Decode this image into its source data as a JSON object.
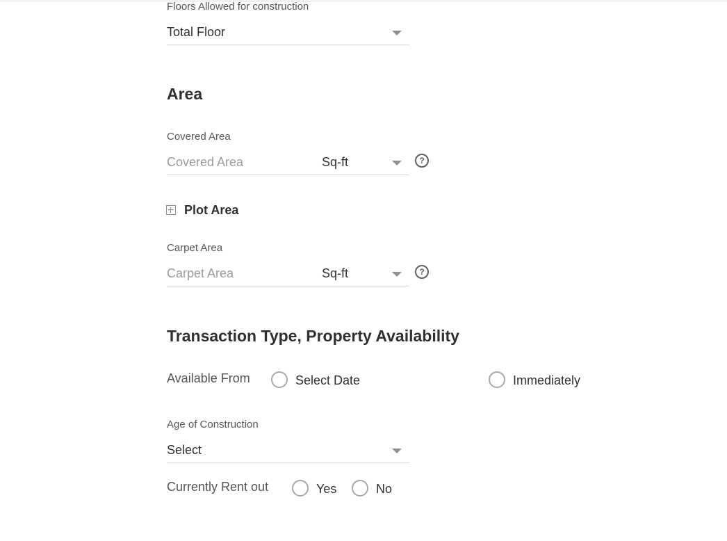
{
  "floors": {
    "label": "Floors Allowed for construction",
    "value": "Total Floor",
    "caret_icon": "chevron-down-icon"
  },
  "area": {
    "heading": "Area",
    "covered": {
      "label": "Covered Area",
      "placeholder": "Covered Area",
      "unit": "Sq-ft",
      "help": "?"
    },
    "plot": {
      "label": "Plot Area",
      "icon": "expand-plus-icon"
    },
    "carpet": {
      "label": "Carpet Area",
      "placeholder": "Carpet Area",
      "unit": "Sq-ft",
      "help": "?"
    }
  },
  "transaction": {
    "heading": "Transaction Type, Property Availability",
    "available_from": {
      "label": "Available From",
      "options": [
        "Select Date",
        "Immediately"
      ]
    },
    "age": {
      "label": "Age of Construction",
      "value": "Select"
    },
    "rent_out": {
      "label": "Currently Rent out",
      "options": [
        "Yes",
        "No"
      ]
    }
  }
}
